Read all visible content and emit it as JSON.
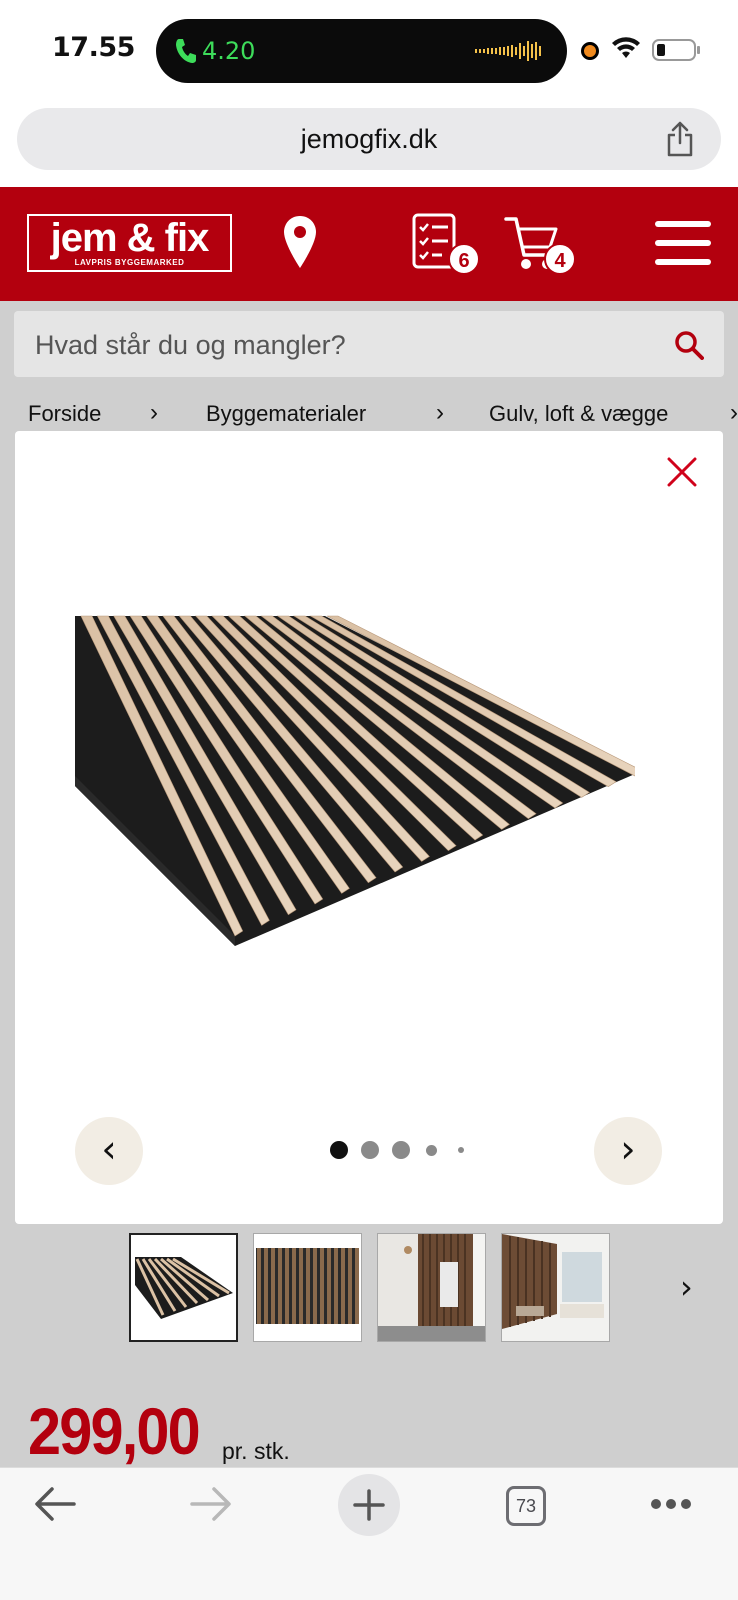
{
  "status_bar": {
    "time": "17.55",
    "call_duration": "4.20"
  },
  "browser": {
    "url": "jemogfix.dk",
    "tabs_count": "73"
  },
  "site": {
    "logo_name": "jem & fix",
    "logo_tagline": "LAVPRIS BYGGEMARKED",
    "list_badge": "6",
    "cart_badge": "4",
    "search_placeholder": "Hvad står du og mangler?",
    "breadcrumb": [
      "Forside",
      "Byggematerialer",
      "Gulv, loft & vægge"
    ]
  },
  "gallery": {
    "dots_total": 5,
    "active_dot": 1,
    "prev_label": "‹",
    "next_label": "›",
    "thumb_next": "›"
  },
  "price": {
    "amount": "299,00",
    "unit": "pr. stk."
  },
  "colors": {
    "brand_red": "#b3000e",
    "call_green": "#3ddc5a"
  }
}
